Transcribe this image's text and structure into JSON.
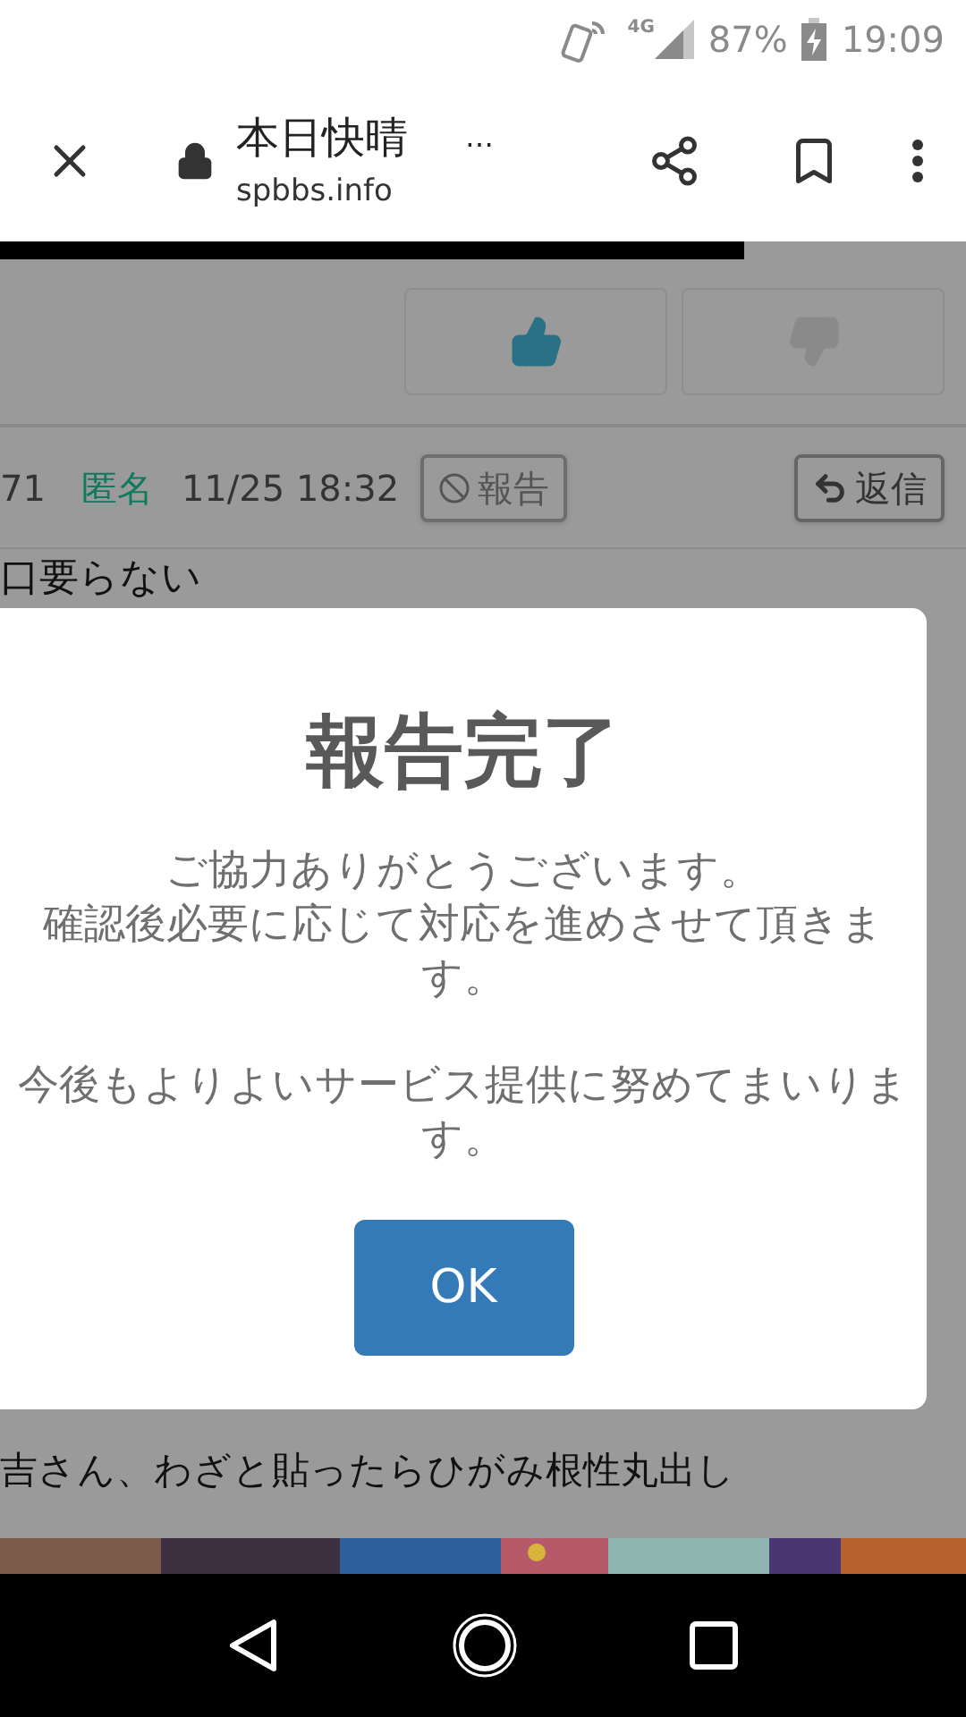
{
  "status_bar": {
    "network": "4G",
    "battery": "87%",
    "time": "19:09"
  },
  "browser": {
    "title": "本日快晴",
    "more": "…",
    "url": "spbbs.info",
    "load_progress": {
      "level": 0.77
    }
  },
  "vote": {
    "buttons": [
      {
        "kind": "up",
        "selected": true
      },
      {
        "kind": "down",
        "selected": false
      }
    ]
  },
  "post": {
    "number": "71",
    "author": "匿名",
    "date": "11/25 18:32",
    "report_button": {
      "label": "報告",
      "disabled": true
    },
    "reply_button": {
      "label": "返信"
    },
    "text": "口要らない"
  },
  "dialog": {
    "title": "報告完了",
    "paragraphs": [
      [
        "ご協力ありがとうございます。",
        "確認後必要に応じて対応を進めさせて頂きます。"
      ],
      [
        "今後もよりよいサービス提供に努めてまいります。"
      ]
    ],
    "button": "OK"
  },
  "next_post": {
    "text": "吉さん、わざと貼ったらひがみ根性丸出し"
  }
}
